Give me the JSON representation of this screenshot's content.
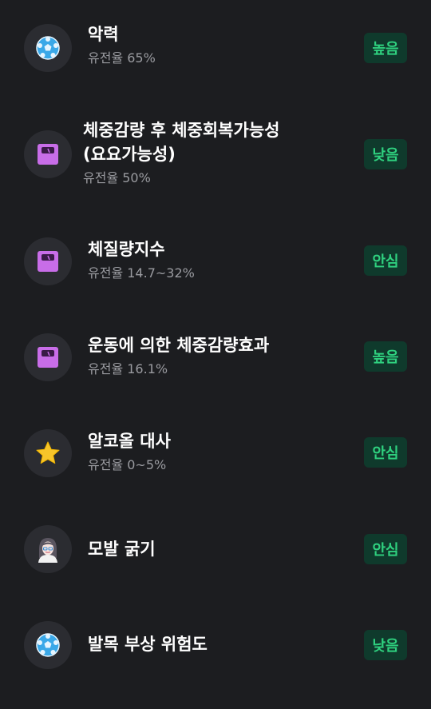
{
  "items": [
    {
      "title": "악력",
      "subtitle": "유전율 65%",
      "badge": "높음",
      "icon": "soccer-ball-icon"
    },
    {
      "title": "체중감량 후 체중회복가능성",
      "title2": "(요요가능성)",
      "subtitle": "유전율 50%",
      "badge": "낮음",
      "icon": "scale-icon"
    },
    {
      "title": "체질량지수",
      "subtitle": "유전율 14.7~32%",
      "badge": "안심",
      "icon": "scale-icon"
    },
    {
      "title": "운동에 의한 체중감량효과",
      "subtitle": "유전율 16.1%",
      "badge": "높음",
      "icon": "scale-icon"
    },
    {
      "title": "알코올 대사",
      "subtitle": "유전율 0~5%",
      "badge": "안심",
      "icon": "star-icon"
    },
    {
      "title": "모발 굵기",
      "badge": "안심",
      "icon": "person-avatar-icon"
    },
    {
      "title": "발목 부상 위험도",
      "badge": "낮음",
      "icon": "soccer-ball-icon"
    }
  ],
  "colors": {
    "background": "#1c1d20",
    "badge_bg": "#0f3a2c",
    "badge_text": "#2fd17f"
  }
}
